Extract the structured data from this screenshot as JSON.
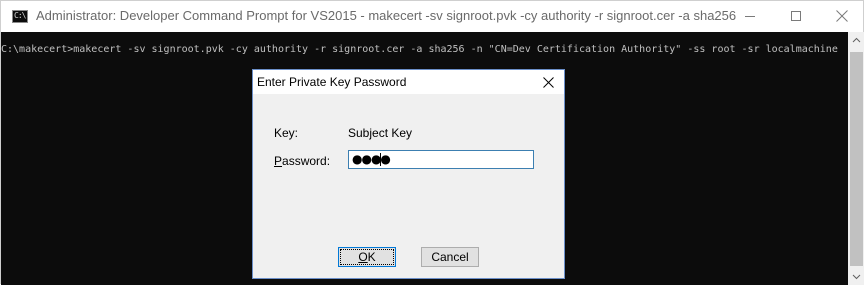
{
  "window": {
    "title": "Administrator: Developer Command Prompt for VS2015 - makecert  -sv signroot.pvk -cy authority -r signroot.cer -a sha256 -n \"C...",
    "app_icon_text": "C:\\",
    "controls": {
      "minimize": "minimize-icon",
      "maximize": "maximize-icon",
      "close": "close-icon"
    }
  },
  "console": {
    "line": "C:\\makecert>makecert -sv signroot.pvk -cy authority -r signroot.cer -a sha256 -n \"CN=Dev Certification Authority\" -ss root -sr localmachine",
    "background": "#0c0c0c",
    "foreground": "#c0c0c0"
  },
  "dialog": {
    "title": "Enter Private Key Password",
    "key_label": "Key:",
    "key_value": "Subject Key",
    "password_label_mnemonic": "P",
    "password_label_rest": "assword:",
    "password_value": "●●●●",
    "ok_label": "OK",
    "ok_mnemonic": "O",
    "ok_rest": "K",
    "cancel_label": "Cancel",
    "accent": "#0078d7"
  }
}
